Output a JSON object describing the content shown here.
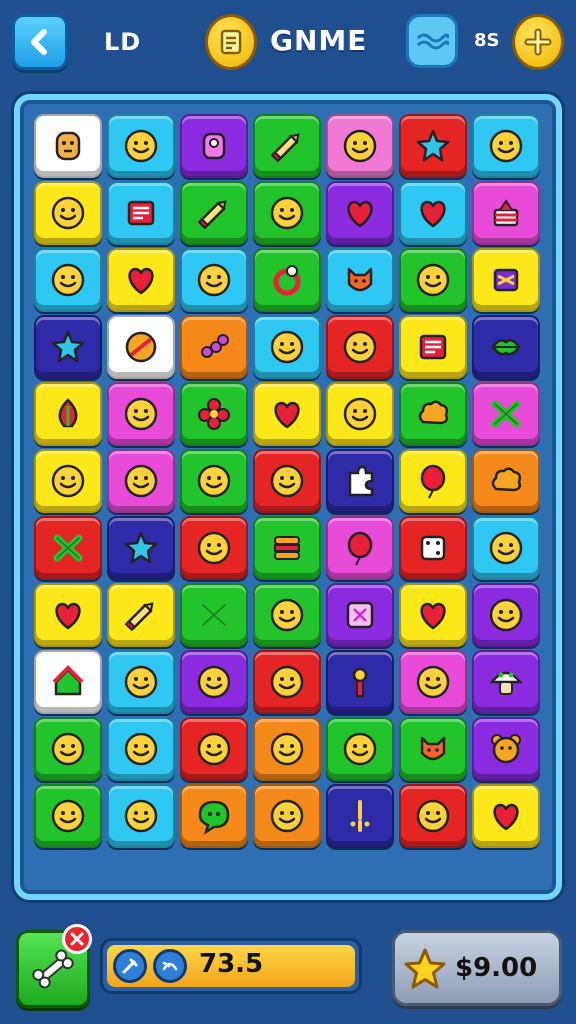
{
  "header": {
    "level_label": "LD",
    "title": "GNME",
    "counter": "8S"
  },
  "footer": {
    "score": "73.5",
    "money": "$9.00"
  },
  "colors": {
    "white": "#ffffff",
    "cyan": "#2fc8f2",
    "purple": "#8a2be0",
    "green": "#21c42a",
    "pink": "#f07ad6",
    "red": "#e52424",
    "yellow": "#ffe81a",
    "navy": "#2e2aa8",
    "orange": "#f58a1a",
    "magenta": "#e84bd8"
  },
  "board": {
    "rows": [
      [
        {
          "bg": "white",
          "icon": "bread-face"
        },
        {
          "bg": "cyan",
          "icon": "smiley"
        },
        {
          "bg": "purple",
          "icon": "robot"
        },
        {
          "bg": "green",
          "icon": "pencil"
        },
        {
          "bg": "pink",
          "icon": "smiley"
        },
        {
          "bg": "red",
          "icon": "star"
        },
        {
          "bg": "cyan",
          "icon": "smiley"
        }
      ],
      [
        {
          "bg": "yellow",
          "icon": "smiley"
        },
        {
          "bg": "cyan",
          "icon": "book"
        },
        {
          "bg": "green",
          "icon": "pencil"
        },
        {
          "bg": "green",
          "icon": "smiley"
        },
        {
          "bg": "purple",
          "icon": "heart"
        },
        {
          "bg": "cyan",
          "icon": "heart"
        },
        {
          "bg": "magenta",
          "icon": "cake"
        }
      ],
      [
        {
          "bg": "cyan",
          "icon": "smiley"
        },
        {
          "bg": "yellow",
          "icon": "heart"
        },
        {
          "bg": "cyan",
          "icon": "smiley"
        },
        {
          "bg": "green",
          "icon": "ring"
        },
        {
          "bg": "cyan",
          "icon": "fox"
        },
        {
          "bg": "green",
          "icon": "smiley"
        },
        {
          "bg": "yellow",
          "icon": "gift"
        }
      ],
      [
        {
          "bg": "navy",
          "icon": "star"
        },
        {
          "bg": "white",
          "icon": "ball"
        },
        {
          "bg": "orange",
          "icon": "grapes"
        },
        {
          "bg": "cyan",
          "icon": "smiley"
        },
        {
          "bg": "red",
          "icon": "smiley"
        },
        {
          "bg": "yellow",
          "icon": "book"
        },
        {
          "bg": "navy",
          "icon": "lips"
        }
      ],
      [
        {
          "bg": "yellow",
          "icon": "leaf"
        },
        {
          "bg": "magenta",
          "icon": "smiley"
        },
        {
          "bg": "green",
          "icon": "flower"
        },
        {
          "bg": "yellow",
          "icon": "heart"
        },
        {
          "bg": "yellow",
          "icon": "smiley"
        },
        {
          "bg": "green",
          "icon": "cloud"
        },
        {
          "bg": "magenta",
          "icon": "cross"
        }
      ],
      [
        {
          "bg": "yellow",
          "icon": "smiley"
        },
        {
          "bg": "magenta",
          "icon": "smiley"
        },
        {
          "bg": "green",
          "icon": "smiley"
        },
        {
          "bg": "red",
          "icon": "smiley"
        },
        {
          "bg": "navy",
          "icon": "puzzle"
        },
        {
          "bg": "yellow",
          "icon": "balloon"
        },
        {
          "bg": "orange",
          "icon": "cloud"
        }
      ],
      [
        {
          "bg": "red",
          "icon": "cross"
        },
        {
          "bg": "navy",
          "icon": "star"
        },
        {
          "bg": "red",
          "icon": "smiley"
        },
        {
          "bg": "green",
          "icon": "burger"
        },
        {
          "bg": "magenta",
          "icon": "balloon"
        },
        {
          "bg": "red",
          "icon": "dice"
        },
        {
          "bg": "cyan",
          "icon": "smiley"
        }
      ],
      [
        {
          "bg": "yellow",
          "icon": "heart"
        },
        {
          "bg": "yellow",
          "icon": "pencil"
        },
        {
          "bg": "green",
          "icon": "cross"
        },
        {
          "bg": "green",
          "icon": "smiley"
        },
        {
          "bg": "purple",
          "icon": "frame"
        },
        {
          "bg": "yellow",
          "icon": "heart"
        },
        {
          "bg": "purple",
          "icon": "smiley"
        }
      ],
      [
        {
          "bg": "white",
          "icon": "house"
        },
        {
          "bg": "cyan",
          "icon": "smiley"
        },
        {
          "bg": "purple",
          "icon": "smiley"
        },
        {
          "bg": "red",
          "icon": "smiley"
        },
        {
          "bg": "navy",
          "icon": "key"
        },
        {
          "bg": "magenta",
          "icon": "smiley"
        },
        {
          "bg": "purple",
          "icon": "mushroom"
        }
      ],
      [
        {
          "bg": "green",
          "icon": "smiley"
        },
        {
          "bg": "cyan",
          "icon": "smiley"
        },
        {
          "bg": "red",
          "icon": "smiley"
        },
        {
          "bg": "orange",
          "icon": "smiley"
        },
        {
          "bg": "green",
          "icon": "smiley"
        },
        {
          "bg": "green",
          "icon": "fox"
        },
        {
          "bg": "purple",
          "icon": "bear"
        }
      ],
      [
        {
          "bg": "green",
          "icon": "smiley"
        },
        {
          "bg": "cyan",
          "icon": "smiley"
        },
        {
          "bg": "orange",
          "icon": "bubble"
        },
        {
          "bg": "orange",
          "icon": "smiley"
        },
        {
          "bg": "navy",
          "icon": "sparkle"
        },
        {
          "bg": "red",
          "icon": "smiley"
        },
        {
          "bg": "yellow",
          "icon": "heart"
        }
      ]
    ]
  }
}
